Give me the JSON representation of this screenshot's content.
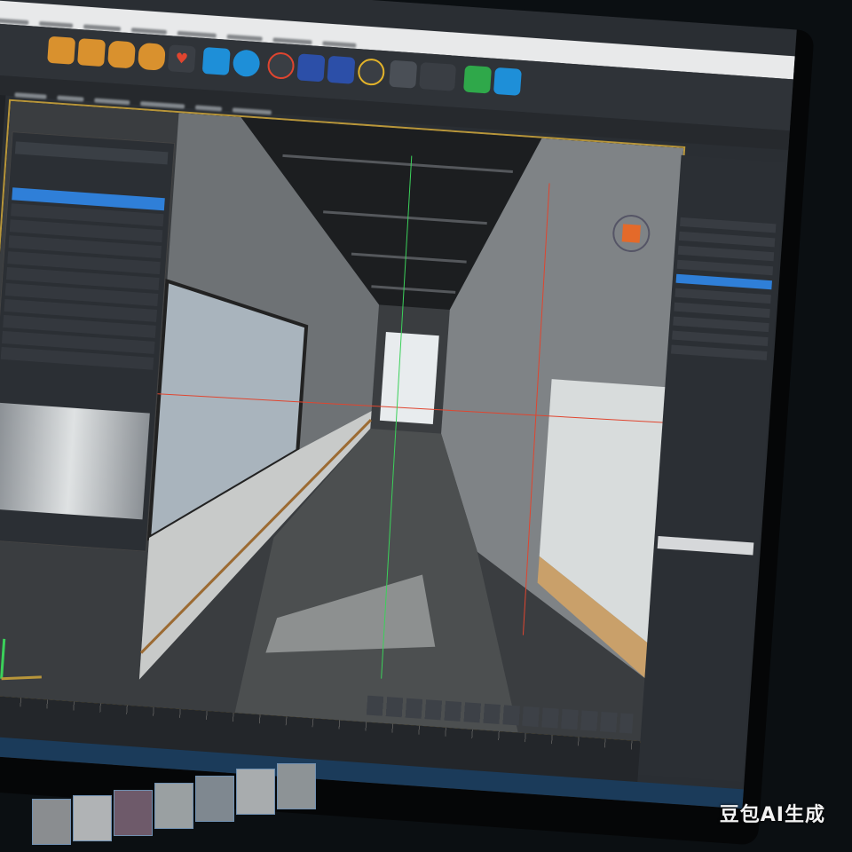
{
  "watermark": {
    "text": "豆包AI生成"
  },
  "colors": {
    "accent_selection": "#2f7fd8",
    "viewport_border": "#b8963a",
    "axis_red": "#e0452f",
    "axis_green": "#3bd15a",
    "gizmo_orange": "#e46a2a"
  },
  "toolbar": {
    "icons": [
      "cube-icon",
      "box-icon",
      "sphere-icon",
      "capsule-icon",
      "light-icon",
      "camera-icon",
      "rotate-icon",
      "target-icon",
      "move-icon",
      "scale-icon",
      "settings-icon",
      "brush-icon",
      "sliders-icon",
      "node-icon",
      "render-icon"
    ]
  }
}
